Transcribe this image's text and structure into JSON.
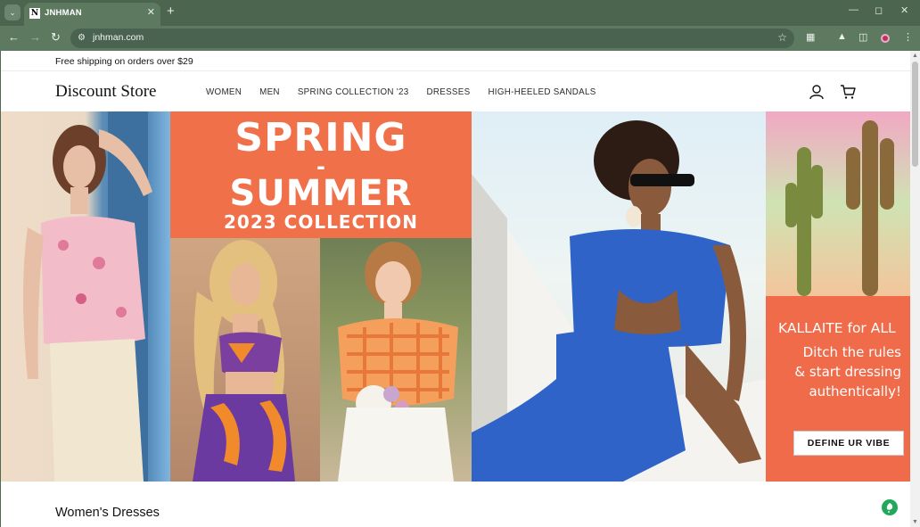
{
  "browser": {
    "tab_title": "JNHMAN",
    "tab_favicon_letter": "N",
    "url": "jnhman.com",
    "accent": "#5d7a60"
  },
  "page": {
    "announcement": "Free shipping on orders over $29",
    "logo": "Discount Store",
    "nav": [
      "WOMEN",
      "MEN",
      "SPRING COLLECTION '23",
      "DRESSES",
      "HIGH-HEELED SANDALS"
    ],
    "hero": {
      "headline_1": "SPRING",
      "headline_dash": "-",
      "headline_2": "SUMMER",
      "headline_3": "2023 COLLECTION",
      "promo_head": "KALLAITE for ALL",
      "promo_line_1": "Ditch the rules",
      "promo_line_2": "& start dressing",
      "promo_line_3": "authentically!",
      "cta": "DEFINE UR VIBE"
    },
    "section_title": "Women's Dresses"
  }
}
